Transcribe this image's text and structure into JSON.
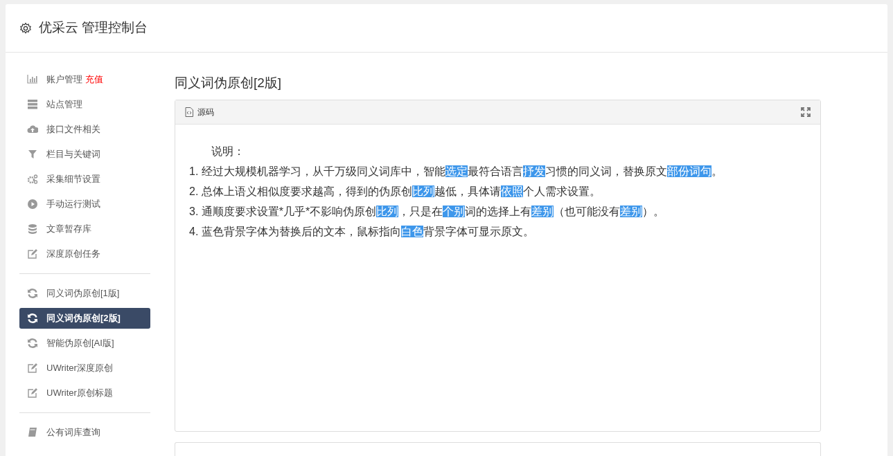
{
  "header": {
    "title": "优采云 管理控制台"
  },
  "sidebar": {
    "groups": [
      {
        "items": [
          {
            "kind": "chart",
            "label": "账户管理",
            "badge": "充值",
            "selected": false
          },
          {
            "kind": "server",
            "label": "站点管理",
            "selected": false
          },
          {
            "kind": "cloud",
            "label": "接口文件相关",
            "selected": false
          },
          {
            "kind": "filter",
            "label": "栏目与关键词",
            "selected": false
          },
          {
            "kind": "gears",
            "label": "采集细节设置",
            "selected": false
          },
          {
            "kind": "play",
            "label": "手动运行测试",
            "selected": false
          },
          {
            "kind": "database",
            "label": "文章暂存库",
            "selected": false
          },
          {
            "kind": "edit",
            "label": "深度原创任务",
            "selected": false
          }
        ]
      },
      {
        "items": [
          {
            "kind": "refresh",
            "label": "同义词伪原创[1版]",
            "selected": false
          },
          {
            "kind": "refresh",
            "label": "同义词伪原创[2版]",
            "selected": true
          },
          {
            "kind": "refresh",
            "label": "智能伪原创[AI版]",
            "selected": false
          },
          {
            "kind": "edit",
            "label": "UWriter深度原创",
            "selected": false
          },
          {
            "kind": "edit",
            "label": "UWriter原创标题",
            "selected": false
          }
        ]
      },
      {
        "items": [
          {
            "kind": "book",
            "label": "公有词库查询",
            "selected": false
          }
        ]
      }
    ]
  },
  "main": {
    "title": "同义词伪原创[2版]",
    "editor": {
      "toolbar_label": "源码",
      "heading": "说明：",
      "lines": [
        [
          {
            "text": "1. 经过大规模机器学习，从千万级同义词库中，智能",
            "highlighted": false
          },
          {
            "text": "选定",
            "highlighted": true
          },
          {
            "text": "最符合语言",
            "highlighted": false
          },
          {
            "text": "抒发",
            "highlighted": true
          },
          {
            "text": "习惯的同义词，替换原文",
            "highlighted": false
          },
          {
            "text": "部份",
            "highlighted": true
          },
          {
            "text": "词句",
            "highlighted": true
          },
          {
            "text": "。",
            "highlighted": false
          }
        ],
        [
          {
            "text": "2. 总体上语义相似度要求越高，得到的伪原创",
            "highlighted": false
          },
          {
            "text": "比列",
            "highlighted": true
          },
          {
            "text": "越低，具体请",
            "highlighted": false
          },
          {
            "text": "依照",
            "highlighted": true
          },
          {
            "text": "个人需求设置。",
            "highlighted": false
          }
        ],
        [
          {
            "text": "3. 通顺度要求设置*几乎*不影响伪原创",
            "highlighted": false
          },
          {
            "text": "比列",
            "highlighted": true
          },
          {
            "text": "，只是在",
            "highlighted": false
          },
          {
            "text": "个别",
            "highlighted": true
          },
          {
            "text": "词的选择上有",
            "highlighted": false
          },
          {
            "text": "差别",
            "highlighted": true
          },
          {
            "text": "（也可能没有",
            "highlighted": false
          },
          {
            "text": "差别",
            "highlighted": true
          },
          {
            "text": "）。",
            "highlighted": false
          }
        ],
        [
          {
            "text": "4. 蓝色背景字体为替换后的文本，鼠标指向",
            "highlighted": false
          },
          {
            "text": "白色",
            "highlighted": true
          },
          {
            "text": "背景字体可显示原文。",
            "highlighted": false
          }
        ]
      ]
    }
  }
}
